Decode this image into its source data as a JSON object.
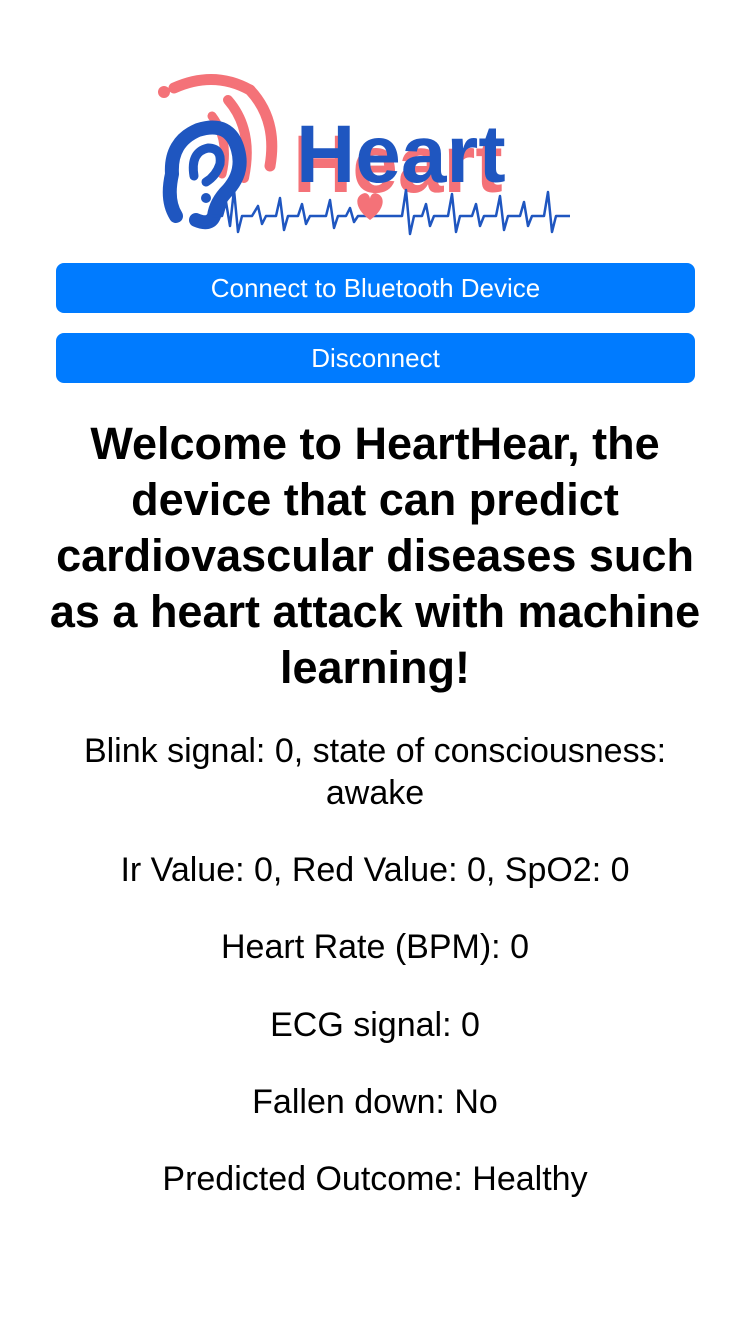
{
  "theme": {
    "button_color": "#007bff",
    "logo_red": "#f47278",
    "logo_blue": "#1f56c0"
  },
  "logo": {
    "text": "Heart",
    "icons": [
      "ear-icon",
      "sound-waves-icon",
      "heartbeat-line-icon",
      "heart-icon"
    ]
  },
  "buttons": {
    "connect_label": "Connect to Bluetooth Device",
    "disconnect_label": "Disconnect"
  },
  "headline": "Welcome to HeartHear, the device that can predict cardiovascular diseases such as a heart attack with machine learning!",
  "readings": {
    "blink": "Blink signal: 0, state of consciousness: awake",
    "oximeter": "Ir Value: 0, Red Value: 0, SpO2: 0",
    "heart_rate": "Heart Rate (BPM): 0",
    "ecg": "ECG signal: 0",
    "fallen": "Fallen down: No",
    "prediction": "Predicted Outcome: Healthy"
  }
}
